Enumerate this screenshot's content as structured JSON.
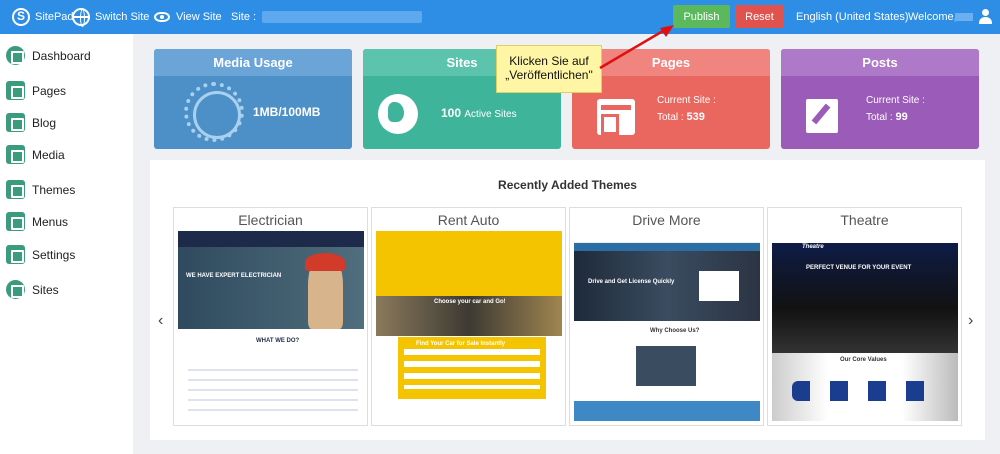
{
  "topbar": {
    "logo": "SitePad",
    "switch_site": "Switch Site",
    "view_site": "View Site",
    "site_label": "Site :",
    "publish": "Publish",
    "reset": "Reset",
    "language": "English (United States)",
    "welcome": "Welcome,"
  },
  "sidebar": {
    "items": [
      {
        "label": "Dashboard",
        "icon": "dashboard-icon"
      },
      {
        "label": "Pages",
        "icon": "pages-icon"
      },
      {
        "label": "Blog",
        "icon": "blog-icon"
      },
      {
        "label": "Media",
        "icon": "media-icon"
      },
      {
        "label": "Themes",
        "icon": "themes-icon"
      },
      {
        "label": "Menus",
        "icon": "menus-icon"
      },
      {
        "label": "Settings",
        "icon": "gear-icon"
      },
      {
        "label": "Sites",
        "icon": "globe-icon"
      }
    ]
  },
  "cards": {
    "media": {
      "title": "Media Usage",
      "value": "1MB/100MB",
      "color": "#4d90c8"
    },
    "sites": {
      "title": "Sites",
      "count": "100",
      "count_label": "Active Sites",
      "color": "#3eb49a"
    },
    "pages": {
      "title": "Pages",
      "current_label": "Current Site :",
      "total_label": "Total :",
      "total": "539",
      "color": "#ea6760"
    },
    "posts": {
      "title": "Posts",
      "current_label": "Current Site :",
      "total_label": "Total :",
      "total": "99",
      "color": "#9b5bb8"
    }
  },
  "themes": {
    "heading": "Recently Added Themes",
    "prev": "‹",
    "next": "›",
    "items": [
      {
        "name": "Electrician"
      },
      {
        "name": "Rent Auto"
      },
      {
        "name": "Drive More"
      },
      {
        "name": "Theatre"
      }
    ]
  },
  "thumb_text": {
    "elec_hero": "WE HAVE EXPERT ELECTRICIAN",
    "elec_section": "WHAT WE DO?",
    "rent_hero": "Choose your car and Go!",
    "rent_form": "Find Your Car for Sale Instantly",
    "drive_hero": "Drive and Get License Quickly",
    "drive_section": "Why Choose Us?",
    "theatre_logo": "Theatre",
    "theatre_hero": "PERFECT VENUE FOR YOUR EVENT",
    "theatre_section": "Our Core Values"
  },
  "callout": {
    "line1": "Klicken Sie auf",
    "line2": "„Veröffentlichen\""
  }
}
